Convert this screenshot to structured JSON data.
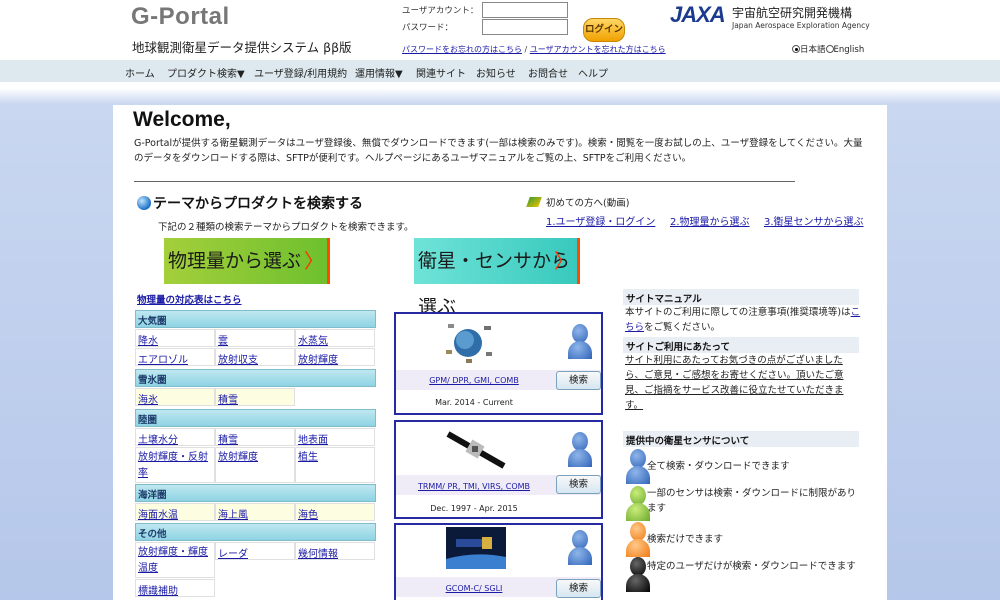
{
  "header": {
    "logo": "G-Portal",
    "subtitle": "地球観測衛星データ提供システム ββ版",
    "user_label": "ユーザアカウント：",
    "pass_label": "パスワード：",
    "login_button": "ログイン",
    "forgot_password": "パスワードをお忘れの方はこちら",
    "link_separator": " / ",
    "forgot_account": "ユーザアカウントを忘れた方はこちら",
    "jaxa_mark": "JAXA",
    "jaxa_jp": "宇宙航空研究開発機構",
    "jaxa_en": "Japan Aerospace Exploration Agency",
    "lang_ja": "日本語",
    "lang_en": "English"
  },
  "nav": [
    "ホーム",
    "プロダクト検索▼",
    "ユーザ登録/利用規約",
    "運用情報▼",
    "関連サイト",
    "お知らせ",
    "お問合せ",
    "ヘルプ"
  ],
  "main": {
    "welcome": "Welcome,",
    "intro": "G-Portalが提供する衛星観測データはユーザ登録後、無償でダウンロードできます(一部は検索のみです)。検索・閲覧を一度お試しの上、ユーザ登録をしてください。大量のデータをダウンロードする際は、SFTPが便利です。ヘルプページにあるユーザマニュアルをご覧の上、SFTPをご利用ください。",
    "section_title": "テーマからプロダクトを検索する",
    "section_sub": "下記の２種類の検索テーマからプロダクトを検索できます。",
    "first_time": "初めての方へ(動画)",
    "video_links": [
      "1.ユーザ登録・ログイン",
      "2.物理量から選ぶ",
      "3.衛星センサから選ぶ"
    ],
    "btn_physical": "物理量から選ぶ",
    "btn_satellite": "衛星・センサから選ぶ",
    "btn_arrow": "〉",
    "correspondence_link": "物理量の対応表はこちら"
  },
  "categories": {
    "atmosphere": {
      "title": "大気圏",
      "items": [
        "降水",
        "雲",
        "水蒸気",
        "エアロゾル",
        "放射収支",
        "放射輝度"
      ]
    },
    "cryosphere": {
      "title": "雪氷圏",
      "items": [
        "海氷",
        "積雪"
      ]
    },
    "land": {
      "title": "陸圏",
      "items": [
        "土壌水分",
        "積雪",
        "地表面",
        "放射輝度・反射率",
        "放射輝度",
        "植生"
      ]
    },
    "ocean": {
      "title": "海洋圏",
      "items": [
        "海面水温",
        "海上風",
        "海色"
      ]
    },
    "other": {
      "title": "その他",
      "items": [
        "放射輝度・輝度温度",
        "レーダ",
        "幾何情報",
        "標識補助"
      ]
    }
  },
  "products": [
    {
      "name": "GPM/ DPR, GMI, COMB",
      "period": "Mar. 2014 - Current",
      "search": "検索"
    },
    {
      "name": "TRMM/ PR, TMI, VIRS, COMB",
      "period": "Dec. 1997 - Apr. 2015",
      "search": "検索"
    },
    {
      "name": "GCOM-C/ SGLI",
      "period": "",
      "search": "検索"
    }
  ],
  "sidebar": {
    "manual_title": "サイトマニュアル",
    "manual_text_before": "本サイトのご利用に際しての注意事項(推奨環境等)は",
    "manual_link": "こちら",
    "manual_text_after": "をご覧ください。",
    "feedback_title": "サイトご利用にあたって",
    "feedback_link": "サイト利用にあたってお気づきの点がございましたら、ご意見・ご感想をお寄せください。頂いたご意見、ご指摘をサービス改善に役立たせていただきます。",
    "legend_title": "提供中の衛星センサについて",
    "legend": [
      {
        "color": "blue",
        "text": "全て検索・ダウンロードできます"
      },
      {
        "color": "green",
        "text": "一部のセンサは検索・ダウンロードに制限があります"
      },
      {
        "color": "orange",
        "text": "検索だけできます"
      },
      {
        "color": "black",
        "text": "特定のユーザだけが検索・ダウンロードできます"
      }
    ]
  }
}
